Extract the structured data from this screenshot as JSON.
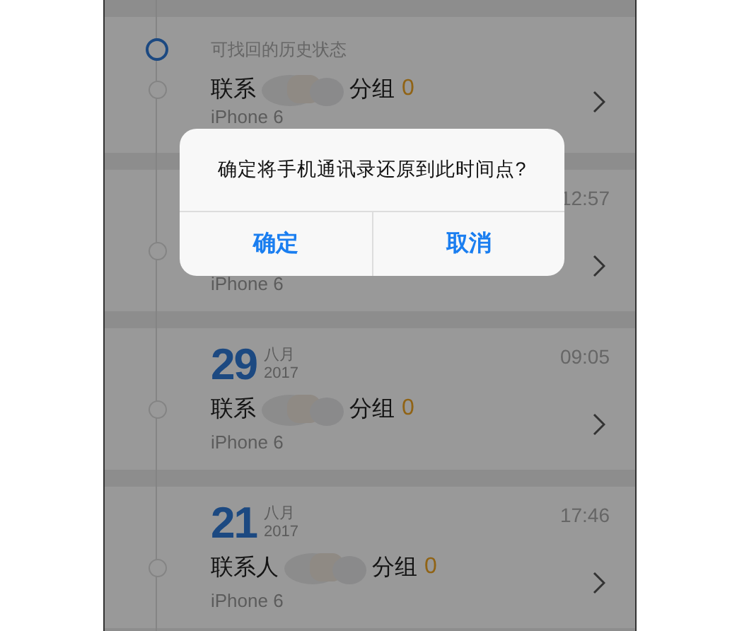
{
  "history": {
    "title": "可找回的历史状态",
    "records": [
      {
        "contact_label": "联系",
        "group_label": "分组",
        "group_count": "0",
        "device": "iPhone 6"
      },
      {
        "time": "12:57",
        "device": "iPhone 6"
      },
      {
        "day": "29",
        "month": "八月",
        "year": "2017",
        "time": "09:05",
        "contact_label": "联系",
        "group_label": "分组",
        "group_count": "0",
        "device": "iPhone 6"
      },
      {
        "day": "21",
        "month": "八月",
        "year": "2017",
        "time": "17:46",
        "contact_label": "联系人",
        "group_label": "分组",
        "group_count": "0",
        "device": "iPhone 6"
      }
    ]
  },
  "dialog": {
    "message": "确定将手机通讯录还原到此时间点?",
    "buttons": [
      "确定",
      "取消"
    ]
  }
}
